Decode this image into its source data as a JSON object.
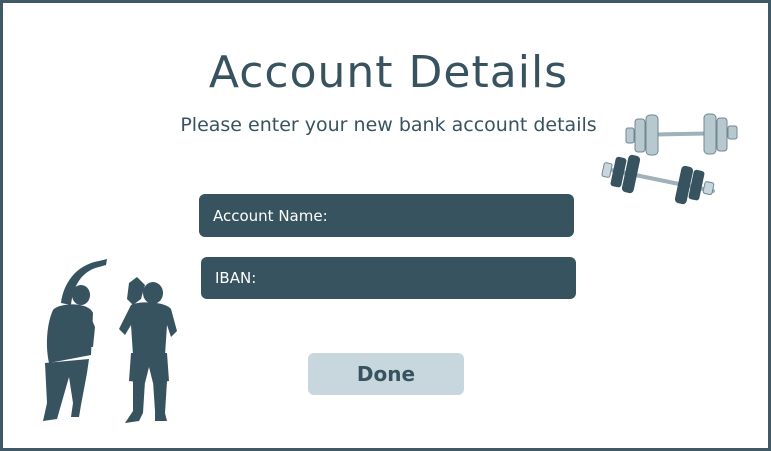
{
  "page": {
    "title": "Account Details",
    "subtitle": "Please enter your new bank account details"
  },
  "form": {
    "account_name_label": "Account Name:",
    "account_name_value": "",
    "iban_label": "IBAN:",
    "iban_value": "",
    "done_label": "Done"
  },
  "colors": {
    "primary": "#37535f",
    "button_bg": "#c8d7de",
    "frame_border": "#3f5a66",
    "dumbbell_light": "#b8c8cf"
  },
  "icons": [
    "dumbbells-illustration",
    "people-exercising-illustration"
  ]
}
